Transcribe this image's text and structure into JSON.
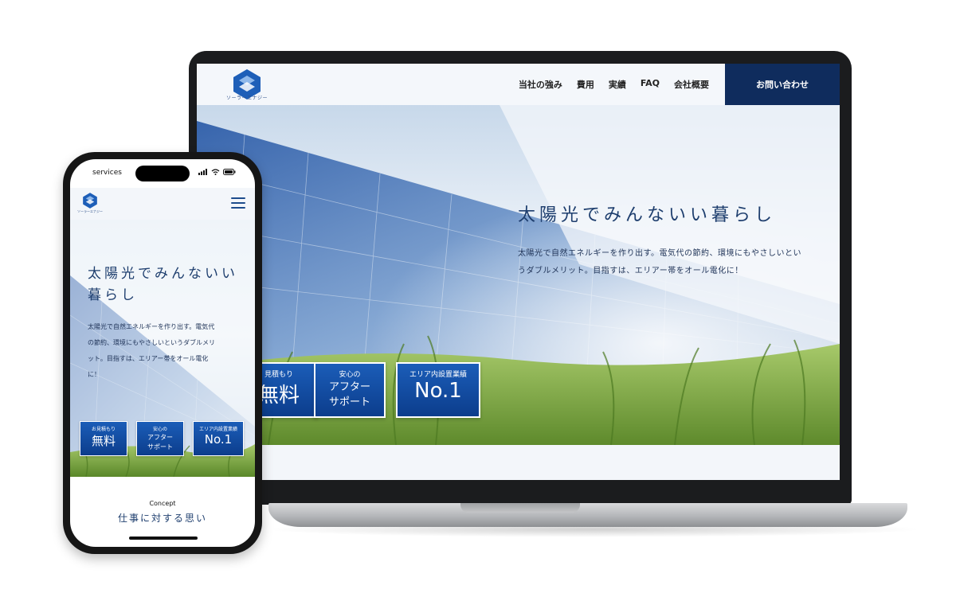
{
  "brand": {
    "name": "ソーラーエナジー",
    "primary_color": "#1e5fb8",
    "dark_color": "#0f2c5d"
  },
  "desktop": {
    "nav": [
      "当社の強み",
      "費用",
      "実績",
      "FAQ",
      "会社概要"
    ],
    "contact_label": "お問い合わせ",
    "hero_title": "太陽光でみんないい暮らし",
    "hero_desc_line1": "太陽光で自然エネルギーを作り出す。電気代の節約、環境にもやさしいとい",
    "hero_desc_line2": "うダブルメリット。目指すは、エリアー帯をオール電化に！",
    "badges": [
      {
        "small": "見積もり",
        "big": "無料"
      },
      {
        "small": "安心の",
        "mid": [
          "アフター",
          "サポート"
        ]
      },
      {
        "small": "エリア内設置業績",
        "big": "No.1"
      }
    ]
  },
  "mobile": {
    "status_left": "services",
    "hero_title_line1": "太陽光でみんないい",
    "hero_title_line2": "暮らし",
    "hero_desc_lines": [
      "太陽光で自然エネルギーを作り出す。電気代",
      "の節約、環境にもやさしいというダブルメリ",
      "ット。目指すは、エリアー帯をオール電化",
      "に！"
    ],
    "badges": [
      {
        "small": "お見積もり",
        "big": "無料"
      },
      {
        "small": "安心の",
        "mid": [
          "アフター",
          "サポート"
        ]
      },
      {
        "small": "エリア内設置業績",
        "big": "No.1"
      }
    ],
    "concept_label": "Concept",
    "concept_title": "仕事に対する思い"
  }
}
